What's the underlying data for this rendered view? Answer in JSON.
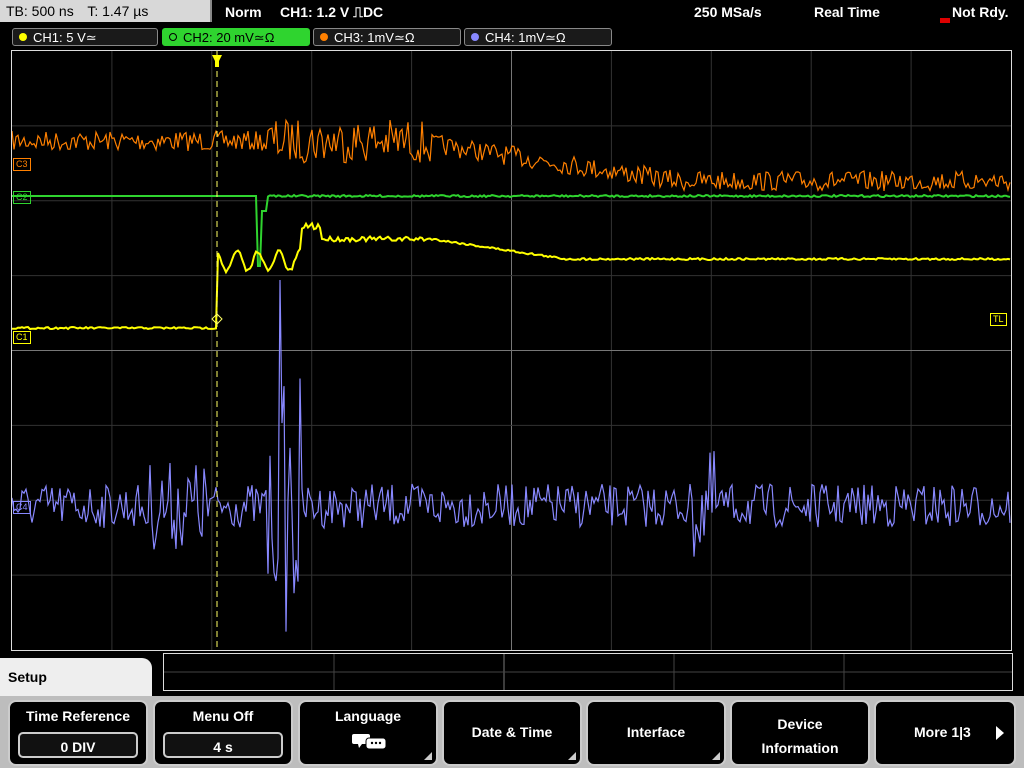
{
  "header": {
    "tb": "TB: 500 ns",
    "t": "T: 1.47 µs",
    "mode": "Norm",
    "trigger": "CH1: 1.2 V ⎍DC",
    "sample_rate": "250 MSa/s",
    "acq": "Real Time",
    "status": "Not Rdy."
  },
  "channels": [
    {
      "label": "CH1: 5 V≃",
      "color": "#ffff00",
      "active": false
    },
    {
      "label": "CH2: 20 mV≃Ω",
      "color": "#2fd42f",
      "active": true
    },
    {
      "label": "CH3: 1mV≃Ω",
      "color": "#ff8000",
      "active": false
    },
    {
      "label": "CH4: 1mV≃Ω",
      "color": "#8888ff",
      "active": false
    }
  ],
  "markers": {
    "c3": "C3",
    "c2": "C2",
    "c1": "C1",
    "c4": "C4",
    "tl": "TL"
  },
  "menu": {
    "title": "Setup",
    "time_reference_label": "Time Reference",
    "time_reference_value": "0 DIV",
    "menu_off_label": "Menu Off",
    "menu_off_value": "4 s",
    "language_label": "Language",
    "date_time_label": "Date & Time",
    "interface_label": "Interface",
    "device_info_line1": "Device",
    "device_info_line2": "Information",
    "more_label": "More 1|3"
  },
  "colors": {
    "ch1": "#ffff00",
    "ch2": "#2fd42f",
    "ch3": "#ff8000",
    "ch4": "#8888ff",
    "grid": "#555555"
  }
}
